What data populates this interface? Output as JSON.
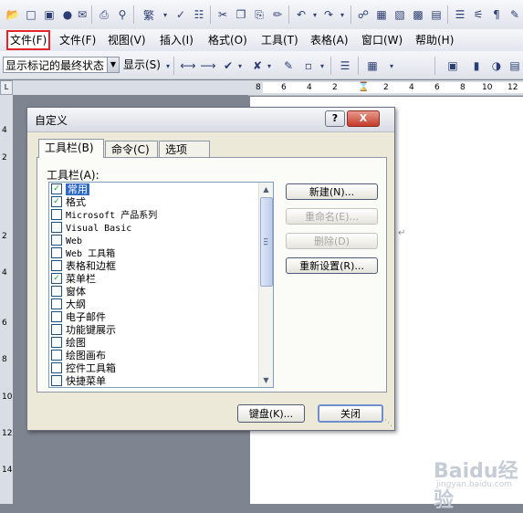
{
  "menu": {
    "items": [
      {
        "label": "文件(F)",
        "highlighted": true
      },
      {
        "label": "文件(F)",
        "highlighted": false
      },
      {
        "label": "视图(V)",
        "highlighted": false
      },
      {
        "label": "插入(I)",
        "highlighted": false
      },
      {
        "label": "格式(O)",
        "highlighted": false
      },
      {
        "label": "工具(T)",
        "highlighted": false
      },
      {
        "label": "表格(A)",
        "highlighted": false
      },
      {
        "label": "窗口(W)",
        "highlighted": false
      },
      {
        "label": "帮助(H)",
        "highlighted": false
      }
    ]
  },
  "toolbar2": {
    "markup_combo": "显示标记的最终状态",
    "show_button": "显示(S)"
  },
  "hruler": {
    "numbers": [
      "8",
      "6",
      "4",
      "2",
      "2",
      "4",
      "6",
      "8",
      "10",
      "12"
    ]
  },
  "vruler": {
    "numbers": [
      "4",
      "2",
      "2",
      "4",
      "6",
      "8",
      "10",
      "12",
      "14"
    ]
  },
  "dialog": {
    "title": "自定义",
    "help_glyph": "?",
    "close_glyph": "X",
    "tabs": [
      {
        "label": "工具栏(B)",
        "active": true
      },
      {
        "label": "命令(C)",
        "active": false
      },
      {
        "label": "选项(O)",
        "active": false
      }
    ],
    "list_label": "工具栏(A):",
    "toolbars": [
      {
        "label": "常用",
        "checked": true,
        "selected": true,
        "mono": false
      },
      {
        "label": "格式",
        "checked": true,
        "selected": false,
        "mono": false
      },
      {
        "label": "Microsoft 产品系列",
        "checked": false,
        "selected": false,
        "mono": true
      },
      {
        "label": "Visual Basic",
        "checked": false,
        "selected": false,
        "mono": true
      },
      {
        "label": "Web",
        "checked": false,
        "selected": false,
        "mono": true
      },
      {
        "label": "Web 工具箱",
        "checked": false,
        "selected": false,
        "mono": true
      },
      {
        "label": "表格和边框",
        "checked": false,
        "selected": false,
        "mono": false
      },
      {
        "label": "菜单栏",
        "checked": true,
        "selected": false,
        "mono": false
      },
      {
        "label": "窗体",
        "checked": false,
        "selected": false,
        "mono": false
      },
      {
        "label": "大纲",
        "checked": false,
        "selected": false,
        "mono": false
      },
      {
        "label": "电子邮件",
        "checked": false,
        "selected": false,
        "mono": false
      },
      {
        "label": "功能键展示",
        "checked": false,
        "selected": false,
        "mono": false
      },
      {
        "label": "绘图",
        "checked": false,
        "selected": false,
        "mono": false
      },
      {
        "label": "绘图画布",
        "checked": false,
        "selected": false,
        "mono": false
      },
      {
        "label": "控件工具箱",
        "checked": false,
        "selected": false,
        "mono": false
      },
      {
        "label": "快捷菜单",
        "checked": false,
        "selected": false,
        "mono": false
      }
    ],
    "buttons": {
      "new": "新建(N)...",
      "rename": "重命名(E)...",
      "delete": "删除(D)",
      "reset": "重新设置(R)...",
      "keyboard": "键盘(K)...",
      "close": "关闭"
    }
  },
  "watermark": {
    "brand": "Baidu经验",
    "url": "jingyan.baidu.com"
  },
  "colors": {
    "selection": "#316ac5",
    "highlight_border": "#e3262b",
    "dialog_bg": "#ece9d8"
  }
}
